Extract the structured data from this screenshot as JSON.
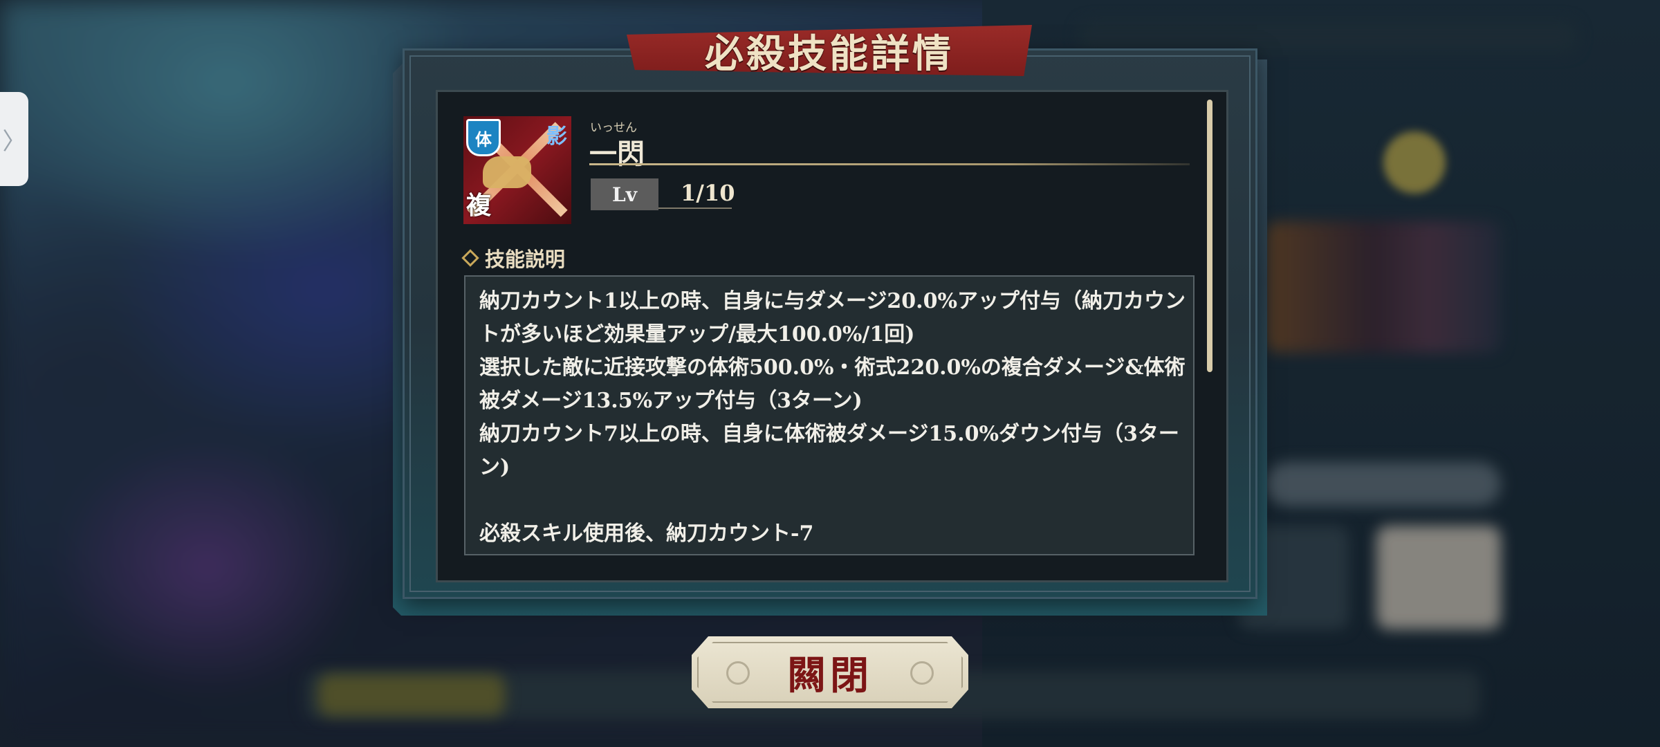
{
  "dialog": {
    "title": "必殺技能詳情",
    "skill": {
      "ruby": "いっせん",
      "name": "一閃",
      "icon": {
        "type_badge": "体",
        "corner_label": "影",
        "bottom_label": "複"
      },
      "level_label": "Lv",
      "level_value": "1/10"
    },
    "description_header": "技能説明",
    "description_lines": [
      "納刀カウント1以上の時、自身に与ダメージ20.0%アップ付与（納刀カウン",
      "トが多いほど効果量アップ/最大100.0%/1回)",
      "選択した敵に近接攻撃の体術500.0%・術式220.0%の複合ダメージ&体術",
      "被ダメージ13.5%アップ付与（3ターン)",
      "納刀カウント7以上の時、自身に体術被ダメージ15.0%ダウン付与（3ター",
      "ン)",
      "",
      "必殺スキル使用後、納刀カウント-7"
    ],
    "close_label": "闗閉"
  },
  "side_tab": {
    "icon": "chevron-right-icon"
  },
  "colors": {
    "banner": "#8a2321",
    "close_text": "#7c1515",
    "panel": "#141b20",
    "frame": "#2a3b45"
  }
}
